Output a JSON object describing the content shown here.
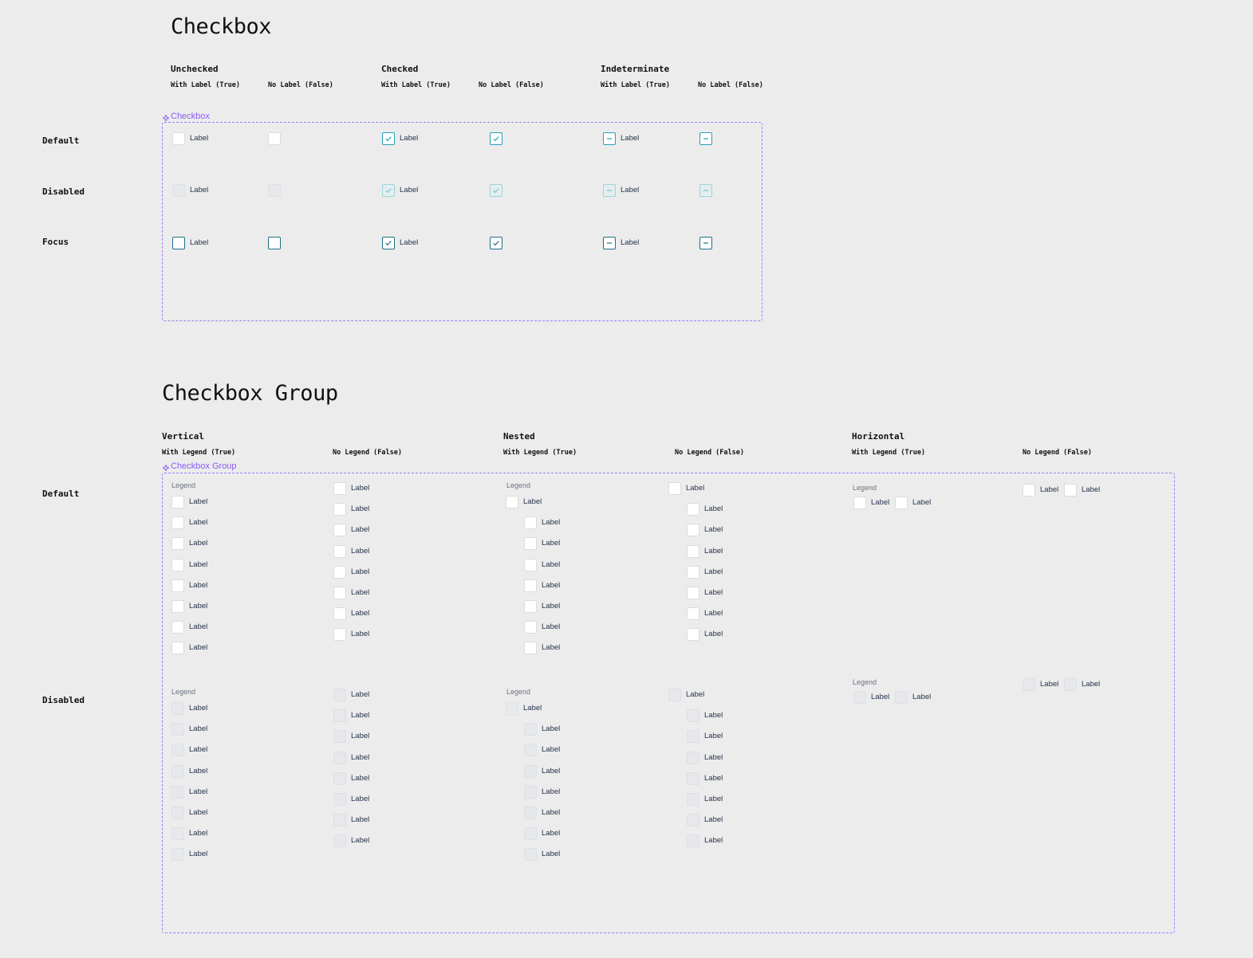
{
  "checkbox": {
    "title": "Checkbox",
    "component_tag": "Checkbox",
    "column_groups": [
      {
        "title": "Unchecked",
        "sub": [
          "With Label (True)",
          "No Label (False)"
        ]
      },
      {
        "title": "Checked",
        "sub": [
          "With Label (True)",
          "No Label (False)"
        ]
      },
      {
        "title": "Indeterminate",
        "sub": [
          "With Label (True)",
          "No Label (False)"
        ]
      }
    ],
    "rows": [
      "Default",
      "Disabled",
      "Focus"
    ],
    "label": "Label"
  },
  "checkbox_group": {
    "title": "Checkbox Group",
    "component_tag": "Checkbox Group",
    "column_groups": [
      {
        "title": "Vertical",
        "sub": [
          "With Legend (True)",
          "No Legend (False)"
        ]
      },
      {
        "title": "Nested",
        "sub": [
          "With Legend (True)",
          "No Legend (False)"
        ]
      },
      {
        "title": "Horizontal",
        "sub": [
          "With Legend (True)",
          "No Legend (False)"
        ]
      }
    ],
    "rows": [
      "Default",
      "Disabled"
    ],
    "legend": "Legend",
    "label": "Label"
  },
  "colors": {
    "accent": "#23a3b3",
    "focus": "#1f6f86",
    "frame": "#9b7bf7",
    "background": "#ececec"
  }
}
